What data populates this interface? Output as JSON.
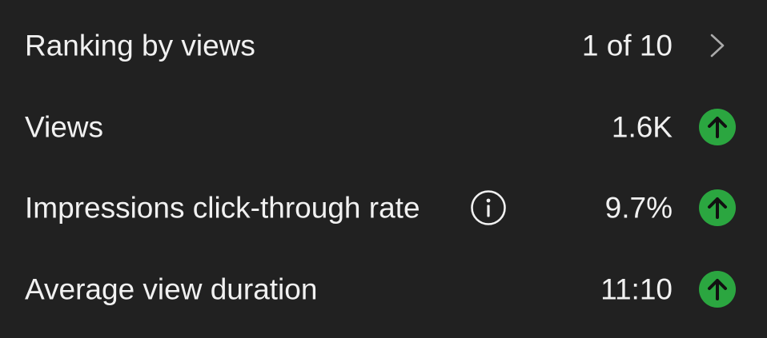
{
  "metrics": {
    "rows": [
      {
        "label": "Ranking by views",
        "value": "1 of 10",
        "trailing_icon": "chevron-right-icon"
      },
      {
        "label": "Views",
        "value": "1.6K",
        "trailing_icon": "trend-up-icon"
      },
      {
        "label": "Impressions click-through rate",
        "value": "9.7%",
        "info_icon": "info-icon",
        "trailing_icon": "trend-up-icon"
      },
      {
        "label": "Average view duration",
        "value": "11:10",
        "trailing_icon": "trend-up-icon"
      }
    ]
  },
  "colors": {
    "background": "#212121",
    "text": "#f1f1f1",
    "trend_up_green": "#2ba640",
    "chevron": "#aaaaaa"
  }
}
